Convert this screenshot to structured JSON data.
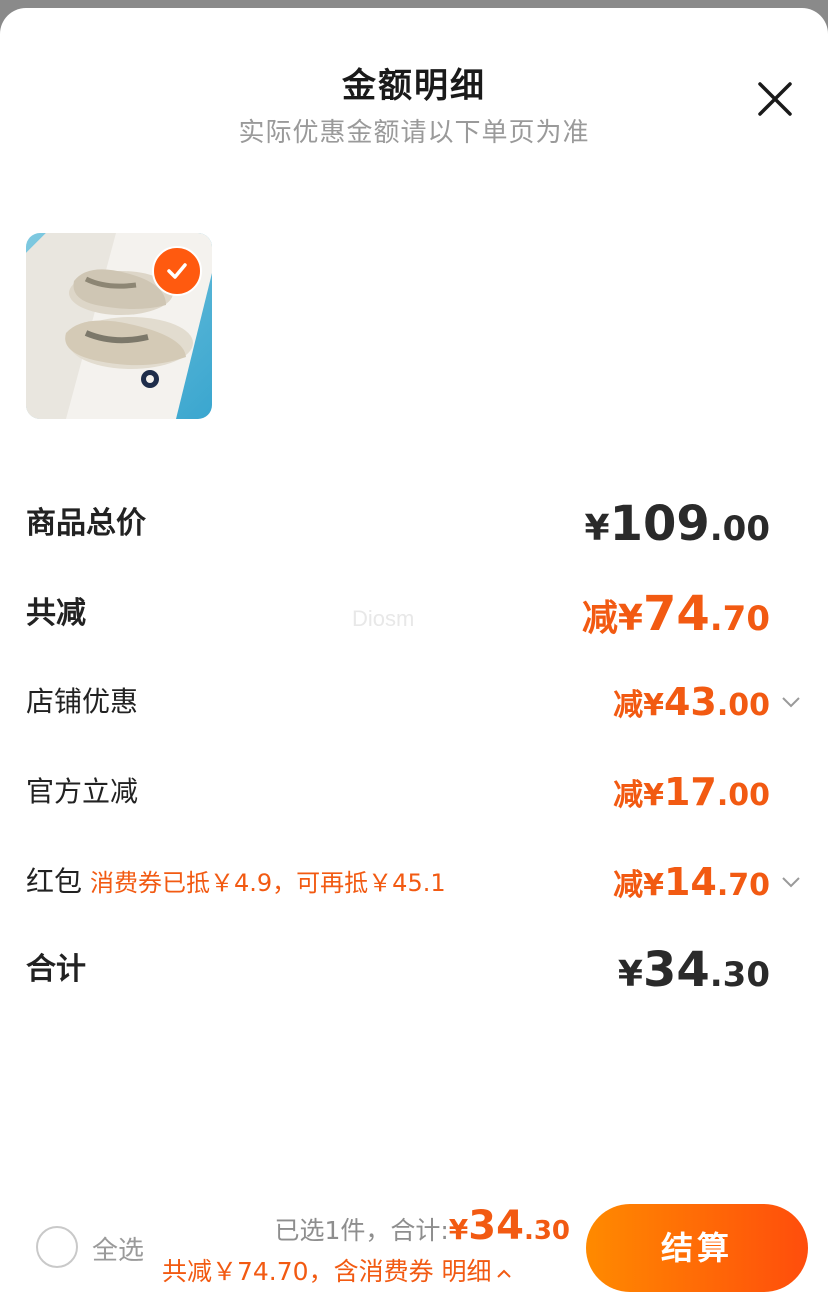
{
  "header": {
    "title": "金额明细",
    "subtitle": "实际优惠金额请以下单页为准"
  },
  "product": {
    "image": "sandals-product-thumbnail",
    "selected": true
  },
  "rows": {
    "total": {
      "label": "商品总价",
      "yen": "¥",
      "int": "109",
      "dec": ".00"
    },
    "reduce": {
      "label": "共减",
      "prefix": "减",
      "yen": "¥",
      "int": "74",
      "dec": ".70"
    },
    "shop": {
      "label": "店铺优惠",
      "prefix": "减",
      "yen": "¥",
      "int": "43",
      "dec": ".00"
    },
    "official": {
      "label": "官方立减",
      "prefix": "减",
      "yen": "¥",
      "int": "17",
      "dec": ".00"
    },
    "redpacket": {
      "label": "红包",
      "note": "消费券已抵￥4.9，可再抵￥45.1",
      "prefix": "减",
      "yen": "¥",
      "int": "14",
      "dec": ".70"
    },
    "sum": {
      "label": "合计",
      "yen": "¥",
      "int": "34",
      "dec": ".30"
    }
  },
  "watermark": "Diosm",
  "footer": {
    "select_all": "全选",
    "selected_text": "已选1件，合计:",
    "yen": "¥",
    "int": "34",
    "dec": ".30",
    "summary": "共减￥74.70，含消费券",
    "detail": "明细",
    "checkout": "结算"
  },
  "colors": {
    "accent": "#f25a12",
    "checkout_gradient_start": "#ff8a00",
    "checkout_gradient_end": "#ff4d0c"
  }
}
